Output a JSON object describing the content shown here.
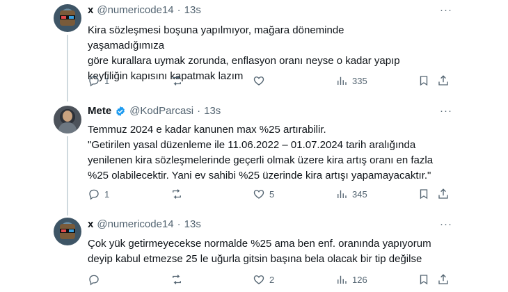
{
  "tweets": [
    {
      "display_name": "x",
      "handle": "@numericode14",
      "separator": "·",
      "time": "13s",
      "text": "Kira sözleşmesi boşuna yapılmıyor, mağara döneminde yaşamadığımıza\ngöre kurallara uymak zorunda, enflasyon oranı neyse o kadar yapıp\nkeyfiliğin kapısını kapatmak lazım",
      "replies": "1",
      "retweets": "",
      "likes": "",
      "views": "335",
      "more": "···"
    },
    {
      "display_name": "Mete",
      "handle": "@KodParcasi",
      "separator": "·",
      "time": "13s",
      "text": "Temmuz 2024 e kadar kanunen max %25 artırabilir.\n\"Getirilen yasal düzenleme ile 11.06.2022 – 01.07.2024 tarih aralığında\nyenilenen kira sözleşmelerinde geçerli olmak üzere kira artış oranı en fazla\n%25 olabilecektir. Yani ev sahibi %25 üzerinde kira artışı yapamayacaktır.\"",
      "replies": "1",
      "retweets": "",
      "likes": "5",
      "views": "345",
      "more": "···"
    },
    {
      "display_name": "x",
      "handle": "@numericode14",
      "separator": "·",
      "time": "13s",
      "text": "Çok yük getirmeyecekse normalde %25 ama ben enf. oranında yapıyorum\ndeyip kabul etmezse 25 le uğurla gitsin başına bela olacak bir tip değilse",
      "replies": "",
      "retweets": "",
      "likes": "2",
      "views": "126",
      "more": "···"
    }
  ],
  "colors": {
    "text": "#0f1419",
    "muted": "#536471",
    "thread": "#cfd9de",
    "verified": "#1d9bf0"
  },
  "icons": [
    "reply-icon",
    "retweet-icon",
    "like-icon",
    "views-icon",
    "bookmark-icon",
    "share-icon",
    "verified-badge-icon",
    "more-icon"
  ]
}
